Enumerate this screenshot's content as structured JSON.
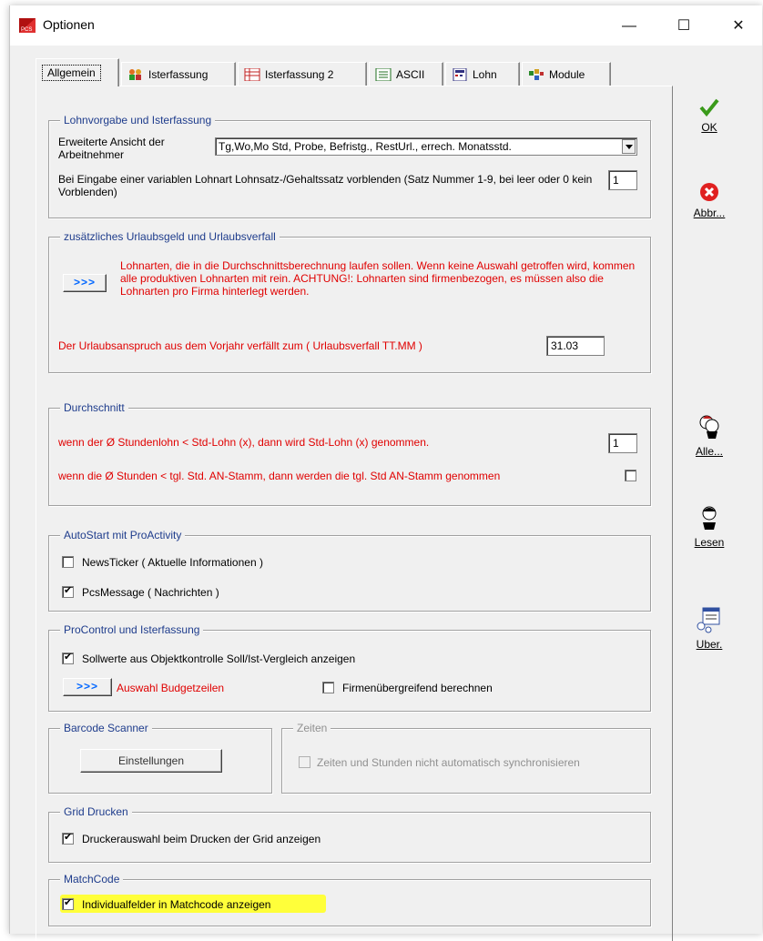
{
  "window": {
    "title": "Optionen",
    "minimize": "—",
    "maximize": "☐",
    "close": "✕"
  },
  "tabs": [
    {
      "label": "Allgemein",
      "icon": "none"
    },
    {
      "label": "Isterfassung",
      "icon": "people-icon"
    },
    {
      "label": "Isterfassung 2",
      "icon": "grid-icon"
    },
    {
      "label": "ASCII",
      "icon": "list-icon"
    },
    {
      "label": "Lohn",
      "icon": "calculator-icon"
    },
    {
      "label": "Module",
      "icon": "modules-icon"
    }
  ],
  "lohnvorgabe": {
    "legend": "Lohnvorgabe und Isterfassung",
    "ansicht_label": "Erweiterte Ansicht der Arbeitnehmer",
    "ansicht_value": "Tg,Wo,Mo Std, Probe, Befristg., RestUrl., errech. Monatsstd.",
    "vorblenden_label": "Bei Eingabe einer variablen Lohnart Lohnsatz-/Gehaltssatz vorblenden (Satz Nummer 1-9, bei leer oder 0 kein Vorblenden)",
    "vorblenden_value": "1"
  },
  "urlaub": {
    "legend": "zusätzliches Urlaubsgeld und Urlaubsverfall",
    "arrow_button": ">>>",
    "lohnarten_text": "Lohnarten, die in die Durchschnittsberechnung laufen sollen. Wenn keine Auswahl getroffen wird, kommen alle produktiven Lohnarten mit rein. ACHTUNG!: Lohnarten sind firmenbezogen, es müssen also die Lohnarten pro Firma hinterlegt werden.",
    "verfall_label": "Der Urlaubsanspruch aus dem Vorjahr verfällt zum ( Urlaubsverfall TT.MM )",
    "verfall_value": "31.03"
  },
  "durchschnitt": {
    "legend": "Durchschnitt",
    "row1_label": "wenn der Ø Stundenlohn < Std-Lohn (x), dann wird Std-Lohn (x)  genommen.",
    "row1_value": "1",
    "row2_label": "wenn die Ø Stunden < tgl. Std. AN-Stamm, dann werden die tgl. Std AN-Stamm genommen",
    "row2_checked": false
  },
  "autostart": {
    "legend": "AutoStart mit ProActivity",
    "newsticker_label": "NewsTicker ( Aktuelle Informationen )",
    "newsticker_checked": false,
    "pcsmessage_label": "PcsMessage ( Nachrichten )",
    "pcsmessage_checked": true
  },
  "procontrol": {
    "legend": "ProControl und Isterfassung",
    "sollwerte_label": "Sollwerte aus Objektkontrolle Soll/Ist-Vergleich anzeigen",
    "sollwerte_checked": true,
    "arrow_button": ">>>",
    "budget_label": "Auswahl Budgetzeilen",
    "firmen_label": "Firmenübergreifend berechnen",
    "firmen_checked": false
  },
  "barcode": {
    "legend": "Barcode Scanner",
    "button": "Einstellungen"
  },
  "zeiten": {
    "legend": "Zeiten",
    "sync_label": "Zeiten und Stunden nicht automatisch synchronisieren",
    "sync_checked": false
  },
  "grid": {
    "legend": "Grid Drucken",
    "drucker_label": "Druckerauswahl beim Drucken der Grid anzeigen",
    "drucker_checked": true
  },
  "matchcode": {
    "legend": "MatchCode",
    "individual_label": "Individualfelder in Matchcode anzeigen",
    "individual_checked": true,
    "highlight_color": "#ffff3a"
  },
  "side_buttons": {
    "ok": "OK",
    "abbr": "Abbr...",
    "alle": "Alle...",
    "lesen": "Lesen",
    "uber": "Uber."
  },
  "colors": {
    "legend_blue": "#1e3c8c",
    "warning_red": "#e00000",
    "arrow_blue": "#0066ff",
    "ok_green": "#3a9a1a",
    "cancel_red": "#e02020"
  }
}
